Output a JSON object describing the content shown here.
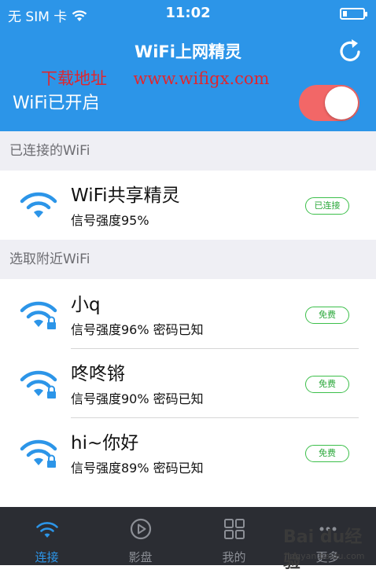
{
  "status_bar": {
    "carrier": "无 SIM 卡",
    "time": "11:02"
  },
  "header": {
    "title": "WiFi上网精灵",
    "watermark": "下载地址     www.wifigx.com",
    "wifi_status_label": "WiFi已开启",
    "wifi_enabled": true
  },
  "connected_section": {
    "title": "已连接的WiFi",
    "item": {
      "name": "WiFi共享精灵",
      "signal": "信号强度95%",
      "badge": "已连接"
    }
  },
  "nearby_section": {
    "title": "选取附近WiFi",
    "items": [
      {
        "name": "小q",
        "signal": "信号强度96% 密码已知",
        "badge": "免费"
      },
      {
        "name": "咚咚锵",
        "signal": "信号强度90% 密码已知",
        "badge": "免费"
      },
      {
        "name": "hi~你好",
        "signal": "信号强度89% 密码已知",
        "badge": "免费"
      }
    ]
  },
  "tabbar": {
    "tabs": [
      {
        "label": "连接",
        "icon": "wifi-icon",
        "active": true
      },
      {
        "label": "影盘",
        "icon": "play-icon"
      },
      {
        "label": "我的",
        "icon": "grid-icon"
      },
      {
        "label": "更多",
        "icon": "more-icon"
      }
    ]
  },
  "baidu_watermark": {
    "logo": "Bai du经验",
    "site": "jingyan.baidu.com"
  },
  "colors": {
    "accent": "#2c95e8",
    "toggle_on": "#f26767",
    "badge_green": "#3cbf4a",
    "tabbar_bg": "#2b2d33"
  }
}
